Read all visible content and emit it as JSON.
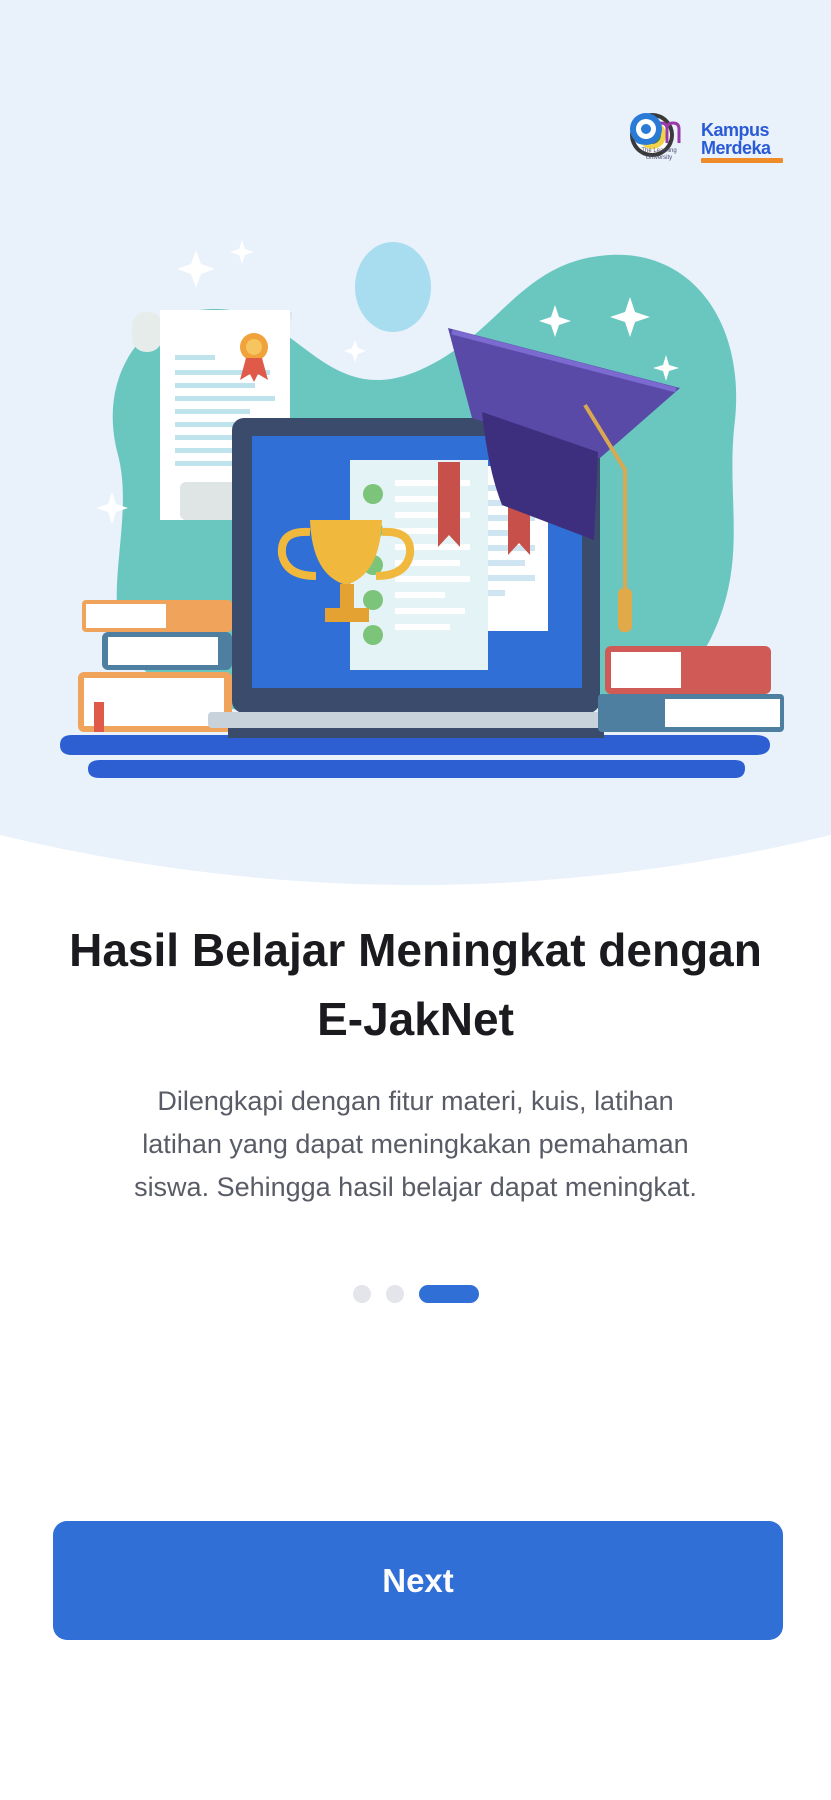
{
  "onboarding": {
    "title": "Hasil Belajar Meningkat dengan E-JakNet",
    "description": "Dilengkapi dengan fitur materi, kuis, latihan\nlatihan yang dapat meningkakan pemahaman\nsiswa. Sehingga hasil belajar  dapat meningkat.",
    "next_label": "Next",
    "pager": {
      "total": 3,
      "current": 3
    }
  },
  "logos": {
    "um_tagline": "The Learning University",
    "kampus_merdeka_line1": "Kampus",
    "kampus_merdeka_line2": "Merdeka"
  },
  "colors": {
    "primary": "#2f6fd6",
    "hero_background": "#e9f1fb",
    "blob": "#6ac7c0",
    "graduation_cap": "#5a4aa8"
  }
}
